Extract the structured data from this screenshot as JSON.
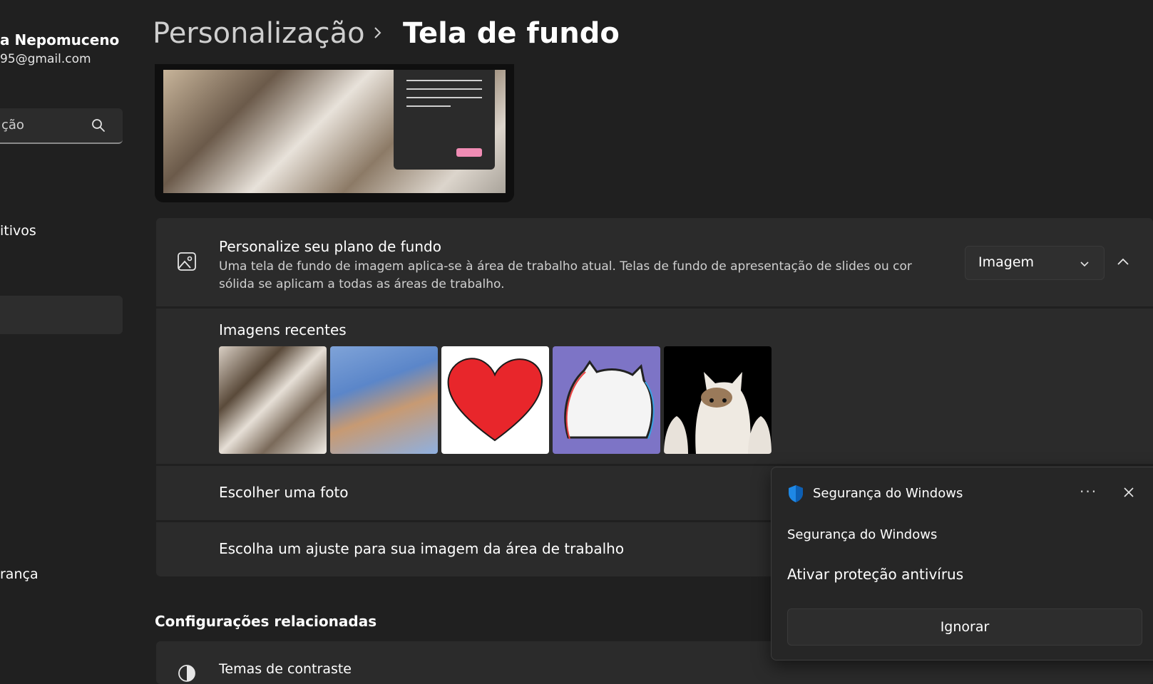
{
  "sidebar": {
    "user_name": "a Nepomuceno",
    "user_email": "95@gmail.com",
    "search_placeholder": "ção",
    "items": [
      {
        "label": "itivos"
      },
      {
        "label": ""
      },
      {
        "label": "rança"
      }
    ]
  },
  "header": {
    "parent": "Personalização",
    "current": "Tela de fundo"
  },
  "background_card": {
    "title": "Personalize seu plano de fundo",
    "description": "Uma tela de fundo de imagem aplica-se à área de trabalho atual. Telas de fundo de apresentação de slides ou cor sólida se aplicam a todas as áreas de trabalho.",
    "dropdown_value": "Imagem"
  },
  "recent": {
    "title": "Imagens recentes"
  },
  "choose_photo": "Escolher uma foto",
  "choose_fit": "Escolha um ajuste para sua imagem da área de trabalho",
  "related": {
    "title": "Configurações relacionadas",
    "contrast": "Temas de contraste"
  },
  "toast": {
    "app_name": "Segurança do Windows",
    "more": "···",
    "heading": "Segurança do Windows",
    "body": "Ativar proteção antivírus",
    "button": "Ignorar"
  },
  "colors": {
    "background": "#202020",
    "card": "#2b2b2b",
    "accent_pink": "#f08cb4",
    "shield_blue": "#1e88e5",
    "heart_red": "#e8262b"
  }
}
